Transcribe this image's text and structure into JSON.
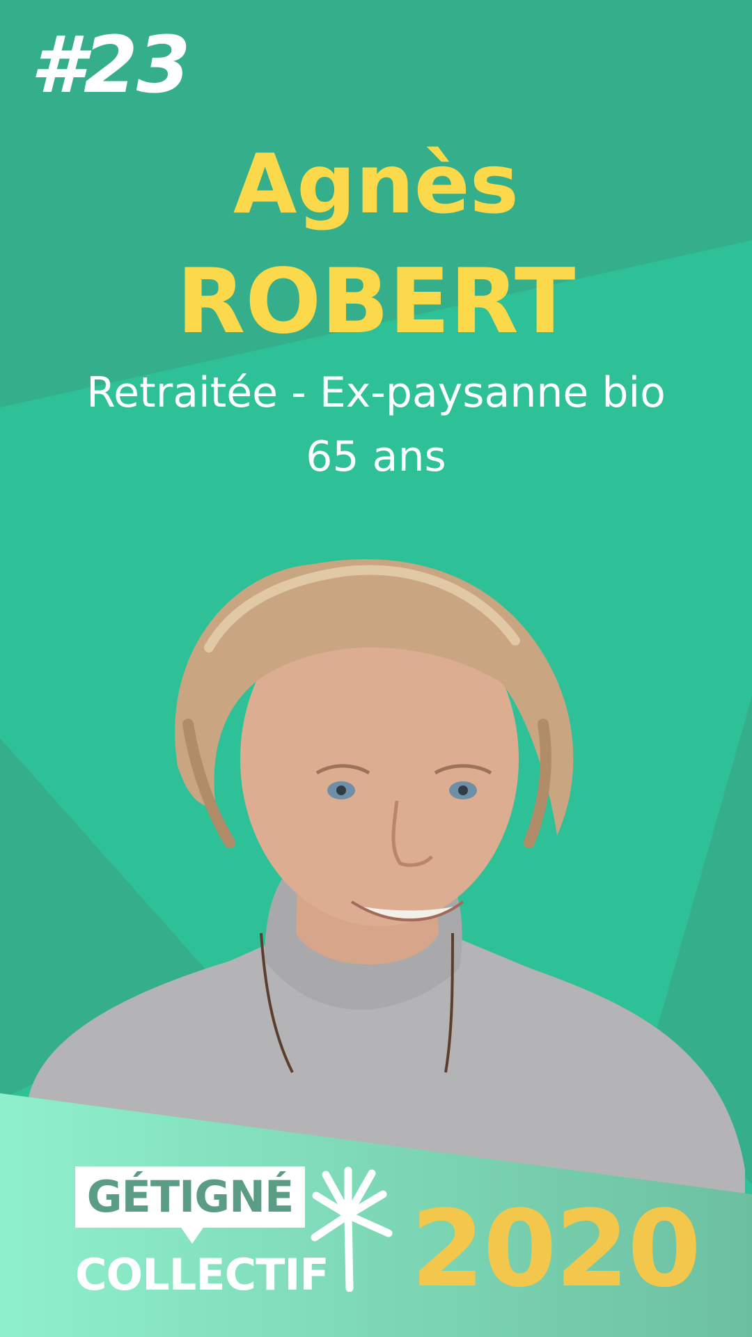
{
  "card": {
    "number": "#23",
    "first_name": "Agnès",
    "last_name": "ROBERT",
    "occupation": "Retraitée - Ex-paysanne bio",
    "age": "65 ans"
  },
  "logo": {
    "line1": "GÉTIGNÉ",
    "line2": "COLLECTIF",
    "year": "2020"
  },
  "colors": {
    "background": "#2ec096",
    "background_dark": "#34ae8b",
    "name_yellow": "#fcd94a",
    "year_yellow": "#f3c74c",
    "footer_light": "#8ff0cc",
    "footer_dark": "#6cc0a0"
  }
}
